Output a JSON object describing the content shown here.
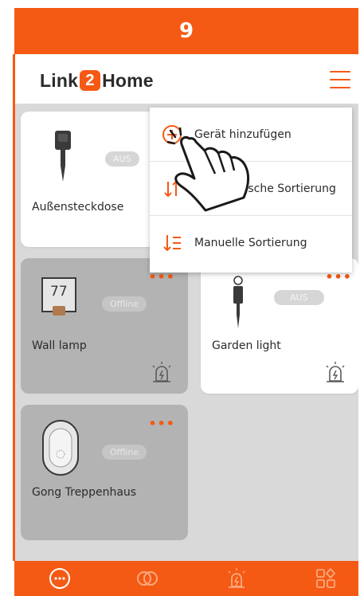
{
  "step": {
    "number": "9"
  },
  "header": {
    "logo_left": "Link",
    "logo_two": "2",
    "logo_right": "Home",
    "menu_icon": "hamburger-menu-icon"
  },
  "devices": [
    {
      "name": "Außensteckdose",
      "status": "AUS",
      "icon": "outdoor-plug-icon",
      "offline": false
    },
    {
      "name": "Wall lamp",
      "status": "Offline",
      "icon": "wall-lamp-icon",
      "number": "77",
      "offline": true
    },
    {
      "name": "Garden light",
      "status": "AUS",
      "icon": "garden-light-icon",
      "offline": false
    },
    {
      "name": "Gong Treppenhaus",
      "status": "Offline",
      "icon": "gong-icon",
      "offline": true
    }
  ],
  "dropdown": {
    "items": [
      {
        "label": "Gerät hinzufügen",
        "icon": "add-circle-icon"
      },
      {
        "label": "tische Sortierung",
        "icon": "sort-auto-icon"
      },
      {
        "label": "Manuelle Sortierung",
        "icon": "sort-manual-icon"
      }
    ]
  },
  "nav": {
    "items": [
      {
        "icon": "devices-icon",
        "active": true
      },
      {
        "icon": "links-icon",
        "active": false
      },
      {
        "icon": "alarm-icon",
        "active": false
      },
      {
        "icon": "grid-icon",
        "active": false
      }
    ]
  },
  "colors": {
    "accent": "#f55a14",
    "nav_inactive": "#f9a87e"
  }
}
